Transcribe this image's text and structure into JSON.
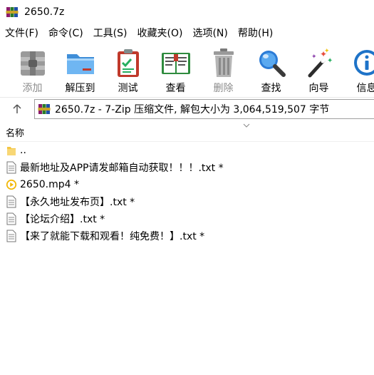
{
  "window": {
    "title": "2650.7z",
    "app_icon": "winrar-books-icon"
  },
  "menu": {
    "items": [
      "文件(F)",
      "命令(C)",
      "工具(S)",
      "收藏夹(O)",
      "选项(N)",
      "帮助(H)"
    ]
  },
  "toolbar": {
    "buttons": [
      {
        "label": "添加",
        "icon": "add-archive-icon",
        "enabled": false
      },
      {
        "label": "解压到",
        "icon": "extract-folder-icon",
        "enabled": true
      },
      {
        "label": "测试",
        "icon": "test-clipboard-icon",
        "enabled": true
      },
      {
        "label": "查看",
        "icon": "view-book-icon",
        "enabled": true
      },
      {
        "label": "删除",
        "icon": "trash-icon",
        "enabled": false
      },
      {
        "label": "查找",
        "icon": "magnifier-icon",
        "enabled": true
      },
      {
        "label": "向导",
        "icon": "wizard-wand-icon",
        "enabled": true
      },
      {
        "label": "信息",
        "icon": "info-icon",
        "enabled": true
      }
    ]
  },
  "address": {
    "path_text": "2650.7z - 7-Zip 压缩文件, 解包大小为 3,064,519,507 字节"
  },
  "list": {
    "column_name": "名称",
    "rows": [
      {
        "name": "..",
        "icon": "folder-icon"
      },
      {
        "name": "最新地址及APP请发邮箱自动获取！！！.txt *",
        "icon": "text-file-icon"
      },
      {
        "name": "2650.mp4 *",
        "icon": "video-file-icon"
      },
      {
        "name": "【永久地址发布页】.txt *",
        "icon": "text-file-icon"
      },
      {
        "name": "【论坛介绍】.txt *",
        "icon": "text-file-icon"
      },
      {
        "name": "【来了就能下载和观看！纯免费！】.txt *",
        "icon": "text-file-icon"
      }
    ]
  },
  "colors": {
    "accent_blue": "#1e73c8",
    "disabled_text": "#8c8c8c",
    "video_icon": "#f2b705"
  }
}
